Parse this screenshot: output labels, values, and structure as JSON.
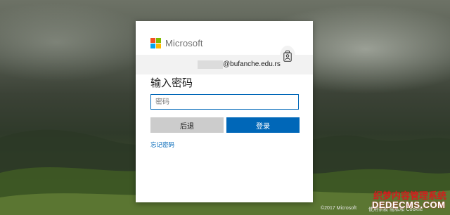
{
  "header": {
    "brand": "Microsoft",
    "logo_colors": [
      "#f25022",
      "#7fba00",
      "#00a4ef",
      "#ffb900"
    ]
  },
  "account": {
    "email_suffix": "@bufanche.edu.rs",
    "badge_icon": "badge-person-icon"
  },
  "login": {
    "title": "输入密码",
    "password_placeholder": "密码",
    "password_value": "",
    "back_label": "后退",
    "signin_label": "登录",
    "forgot_label": "忘记密码"
  },
  "footer": {
    "copyright": "©2017 Microsoft",
    "terms": "使用条款 隐私和 Cookie"
  },
  "watermark": {
    "line1": "织梦内容管理系统",
    "line2": "DEDECMS.COM"
  },
  "colors": {
    "accent": "#0067b8",
    "back_button": "#cccccc"
  }
}
